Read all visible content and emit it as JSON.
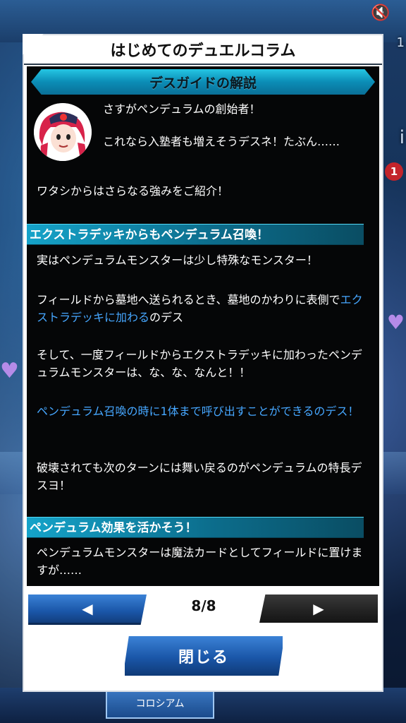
{
  "modal": {
    "title": "はじめてのデュエルコラム",
    "section_title": "デスガイドの解説",
    "intro_line1": "さすがペンデュラムの創始者！",
    "intro_line2": "これなら入塾者も増えそうデスネ！たぶん……",
    "intro_line3": "ワタシからはさらなる強みをご紹介！",
    "subhead1": "エクストラデッキからもペンデュラム召喚！",
    "p1": "実はペンデュラムモンスターは少し特殊なモンスター！",
    "p2_before": "フィールドから墓地へ送られるとき、墓地のかわりに表側で",
    "p2_accent": "エクストラデッキに加わる",
    "p2_after": "のデス",
    "p3": "そして、一度フィールドからエクストラデッキに加わったペンデュラムモンスターは、な、な、なんと！！",
    "p4_accent": "ペンデュラム召喚の時に1体まで呼び出すことができるのデス！",
    "p5": "破壊されても次のターンには舞い戻るのがペンデュラムの特長デスヨ！",
    "subhead2": "ペンデュラム効果を活かそう！",
    "p6": "ペンデュラムモンスターは魔法カードとしてフィールドに置けますが……"
  },
  "pager": {
    "prev_icon": "◀",
    "next_icon": "▶",
    "page_label": "8/8"
  },
  "close_label": "閉じる",
  "background": {
    "bottom_tab": "コロシアム",
    "badge": "1",
    "peek_i": "i",
    "peek_1": "1"
  }
}
